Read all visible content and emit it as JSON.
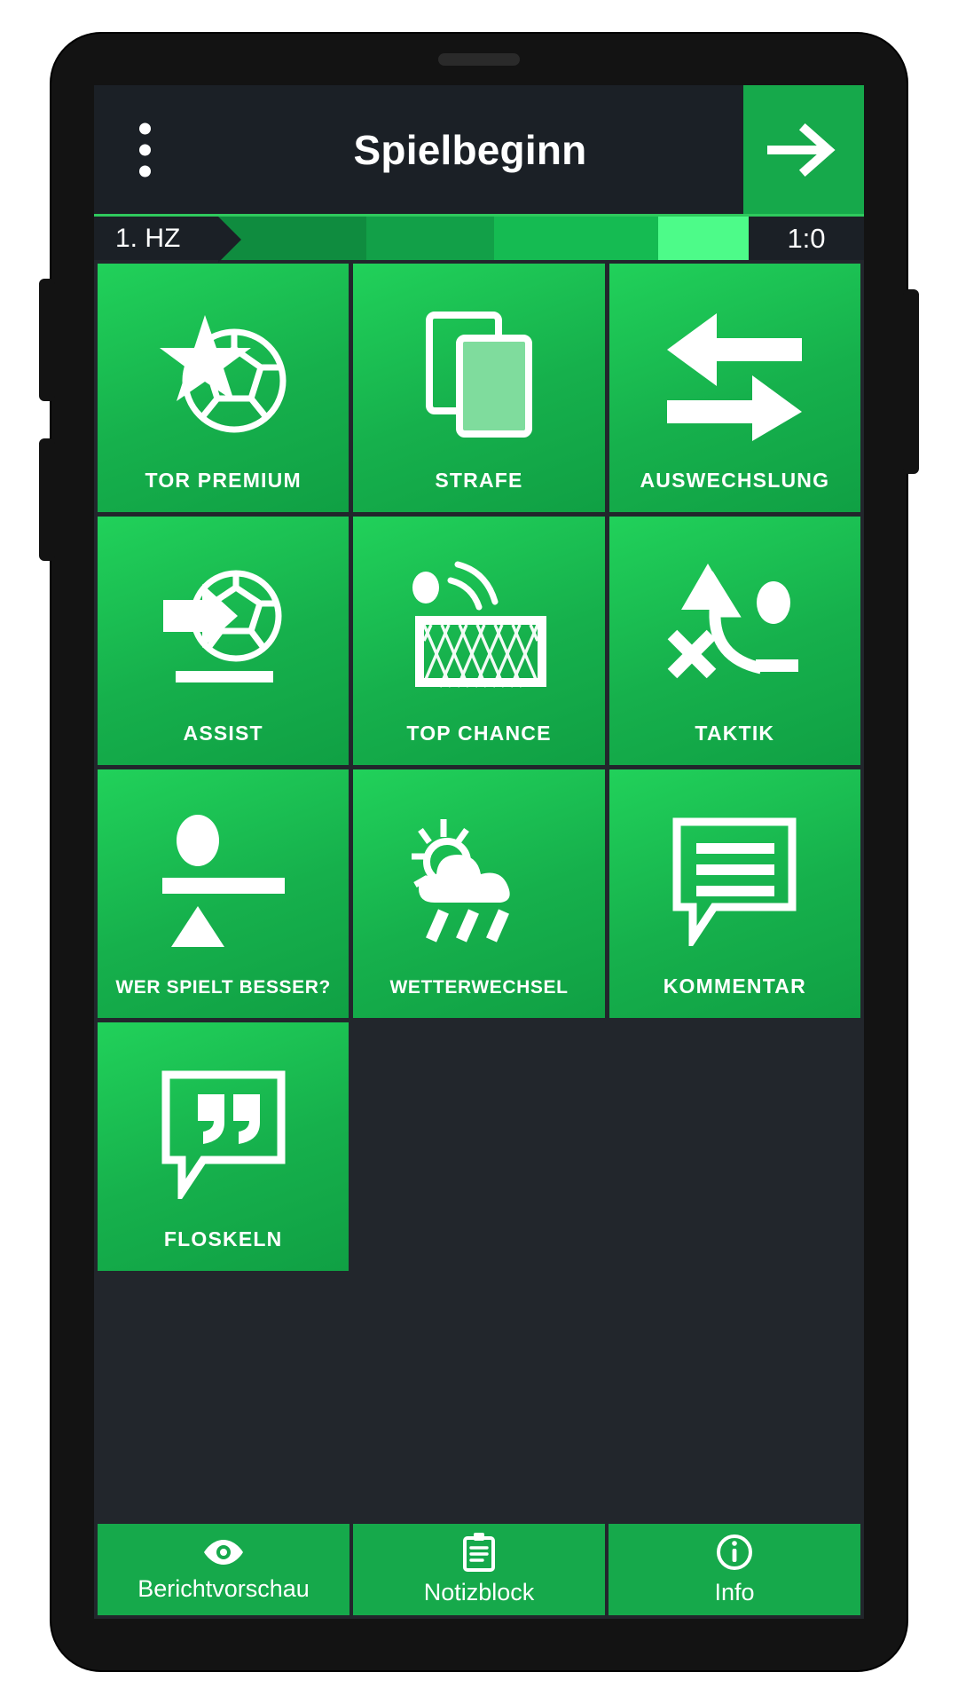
{
  "app": {
    "title": "Spielbeginn",
    "menu_icon": "kebab-menu-icon",
    "next_icon": "arrow-right-icon"
  },
  "period_bar": {
    "period_label": "1. HZ",
    "score": "1:0",
    "segments": [
      {
        "color": "#0f8c3f",
        "width_pct": 28
      },
      {
        "color": "#12a048",
        "width_pct": 24
      },
      {
        "color": "#15bb52",
        "width_pct": 31
      },
      {
        "color": "#4dfb89",
        "width_pct": 17
      }
    ]
  },
  "tiles": [
    {
      "label": "TOR PREMIUM",
      "icon": "ball-star-icon"
    },
    {
      "label": "STRAFE",
      "icon": "cards-icon"
    },
    {
      "label": "AUSWECHSLUNG",
      "icon": "substitution-arrows-icon"
    },
    {
      "label": "ASSIST",
      "icon": "assist-ball-arrow-icon"
    },
    {
      "label": "TOP CHANCE",
      "icon": "goal-net-icon"
    },
    {
      "label": "TAKTIK",
      "icon": "tactics-arrow-icon"
    },
    {
      "label": "WER SPIELT BESSER?",
      "icon": "balance-scale-icon"
    },
    {
      "label": "WETTERWECHSEL",
      "icon": "sun-cloud-rain-icon"
    },
    {
      "label": "KOMMENTAR",
      "icon": "speech-bubble-lines-icon"
    },
    {
      "label": "FLOSKELN",
      "icon": "speech-bubble-quote-icon"
    }
  ],
  "bottom_nav": [
    {
      "label": "Berichtvorschau",
      "icon": "eye-icon"
    },
    {
      "label": "Notizblock",
      "icon": "clipboard-icon"
    },
    {
      "label": "Info",
      "icon": "info-circle-icon"
    }
  ],
  "colors": {
    "accent_green": "#16a94b",
    "bright_green": "#21d15a",
    "highlight_green": "#4dfb89",
    "dark_bg": "#22262c",
    "appbar_bg": "#1b2026"
  }
}
